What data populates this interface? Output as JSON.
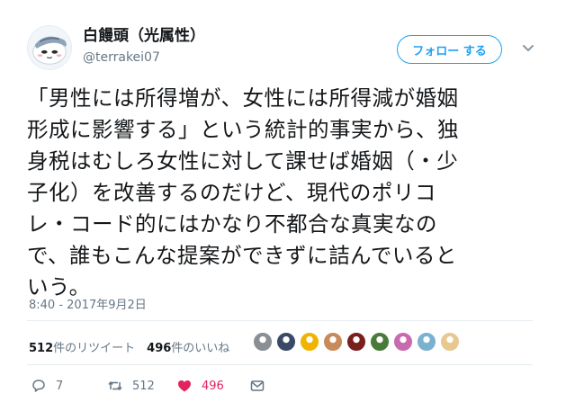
{
  "author": {
    "display_name": "白饅頭（光属性）",
    "handle": "@terrakei07"
  },
  "follow_button": {
    "label": "フォロー する"
  },
  "tweet": {
    "text": "「男性には所得増が、女性には所得減が婚姻\n形成に影響する」という統計的事実から、独\n身税はむしろ女性に対して課せば婚姻（・少\n子化）を改善するのだけど、現代のポリコ\nレ・コード的にはかなり不都合な真実なの\nで、誰もこんな提案ができずに詰んでいると\nいう。",
    "timestamp": "8:40 - 2017年9月2日"
  },
  "stats": {
    "retweets_count": "512",
    "retweets_label": "件のリツイート",
    "likes_count": "496",
    "likes_label": "件のいいね"
  },
  "likers": [
    {
      "color": "#8a8f96"
    },
    {
      "color": "#3a4a66"
    },
    {
      "color": "#f0b400"
    },
    {
      "color": "#c98a5a"
    },
    {
      "color": "#7a1e1e"
    },
    {
      "color": "#4a7a3a"
    },
    {
      "color": "#c86ab0"
    },
    {
      "color": "#7ab0d0"
    },
    {
      "color": "#e8c890"
    }
  ],
  "actions": {
    "reply_count": "7",
    "retweet_count": "512",
    "like_count": "496"
  },
  "colors": {
    "accent": "#1da1f2",
    "like": "#e0245e",
    "muted": "#657786"
  }
}
